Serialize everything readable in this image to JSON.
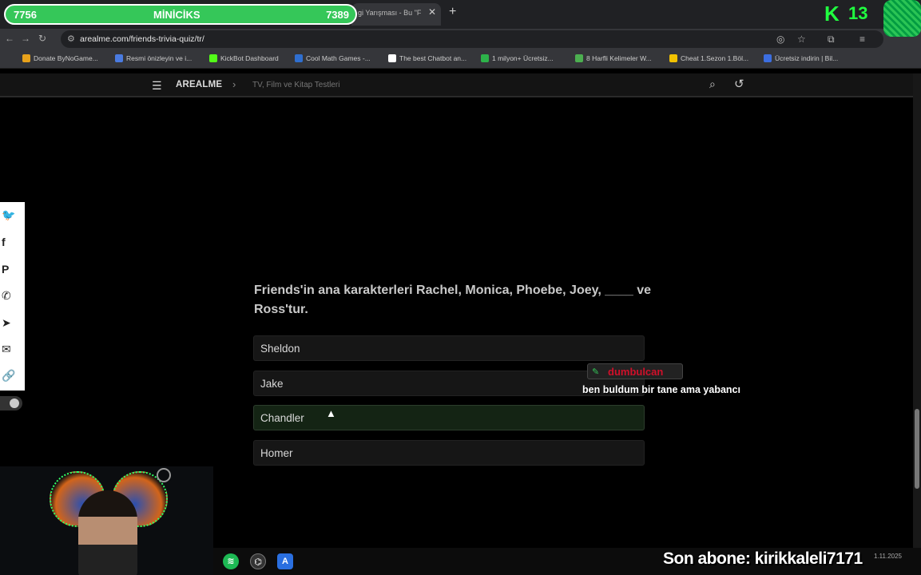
{
  "browser": {
    "tab_title": "gi Yarışması - Bu \"F",
    "url": "arealme.com/friends-trivia-quiz/tr/",
    "bookmarks": [
      "Donate ByNoGame...",
      "Resmi önizleyin ve i...",
      "KickBot Dashboard",
      "Cool Math Games -...",
      "The best Chatbot an...",
      "1 milyon+ Ücretsiz...",
      "8 Harfli Kelimeler W...",
      "Cheat 1.Sezon 1.Böl...",
      "Ücretsiz indirin | Bil..."
    ]
  },
  "overlay": {
    "bar_left": "7756",
    "bar_title": "MİNİCİKS",
    "bar_right": "7389",
    "k_count": "13",
    "subscriber": "Son abone: kirikkaleli7171",
    "clock": "1.11.2025"
  },
  "site": {
    "brand": "AREALME",
    "breadcrumb": "TV, Film ve Kitap Testleri"
  },
  "quiz": {
    "question": "Friends'in ana karakterleri Rachel, Monica, Phoebe, Joey, ____ ve Ross'tur.",
    "options": [
      "Sheldon",
      "Jake",
      "Chandler",
      "Homer"
    ]
  },
  "chat": {
    "username": "dumbulcan",
    "message": "ben buldum bir tane ama yabancı"
  },
  "colors": {
    "bar_green": "#35c759",
    "kick_green": "#20ff40",
    "chat_user": "#d0102a"
  }
}
